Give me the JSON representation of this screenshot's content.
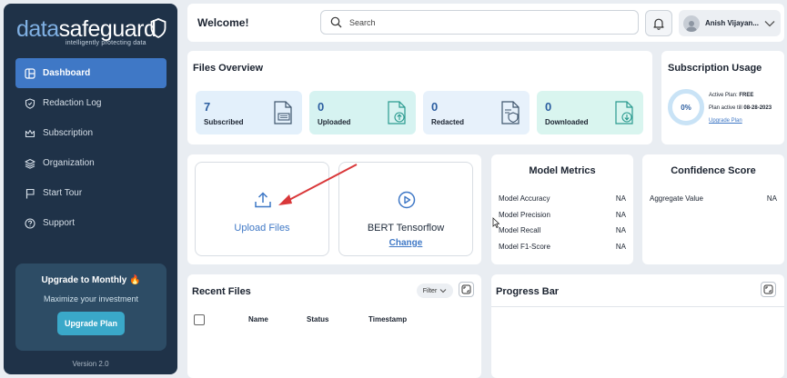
{
  "sidebar": {
    "logo_part1": "data",
    "logo_part2": "safeguard",
    "tagline": "intelligently protecting data",
    "items": [
      {
        "label": "Dashboard",
        "icon": "dashboard-icon",
        "active": true
      },
      {
        "label": "Redaction Log",
        "icon": "shield-icon"
      },
      {
        "label": "Subscription",
        "icon": "crown-icon"
      },
      {
        "label": "Organization",
        "icon": "layers-icon"
      },
      {
        "label": "Start Tour",
        "icon": "flag-icon"
      },
      {
        "label": "Support",
        "icon": "help-icon"
      }
    ],
    "upgrade": {
      "title": "Upgrade to Monthly",
      "subtitle": "Maximize your investment",
      "button": "Upgrade Plan"
    },
    "version": "Version 2.0"
  },
  "header": {
    "welcome": "Welcome!",
    "search_placeholder": "Search",
    "user_name": "Anish Vijayan..."
  },
  "files_overview": {
    "title": "Files Overview",
    "stats": [
      {
        "value": "7",
        "label": "Subscribed",
        "color": "#e3f0fb"
      },
      {
        "value": "0",
        "label": "Uploaded",
        "color": "#d6f3f1"
      },
      {
        "value": "0",
        "label": "Redacted",
        "color": "#e7f1fb"
      },
      {
        "value": "0",
        "label": "Downloaded",
        "color": "#d9f5ef"
      }
    ]
  },
  "subscription_usage": {
    "title": "Subscription Usage",
    "percent": "0%",
    "active_plan_label": "Active Plan:",
    "active_plan": "FREE",
    "active_till_label": "Plan active till",
    "active_till": "08-28-2023",
    "upgrade_link": "Upgrade Plan"
  },
  "model": {
    "upload_label": "Upload Files",
    "model_name": "BERT Tensorflow",
    "change_label": "Change"
  },
  "metrics": {
    "title": "Model Metrics",
    "rows": [
      {
        "label": "Model Accuracy",
        "value": "NA"
      },
      {
        "label": "Model Precision",
        "value": "NA"
      },
      {
        "label": "Model Recall",
        "value": "NA"
      },
      {
        "label": "Model F1-Score",
        "value": "NA"
      }
    ]
  },
  "confidence": {
    "title": "Confidence Score",
    "label": "Aggregate Value",
    "value": "NA"
  },
  "recent_files": {
    "title": "Recent Files",
    "filter": "Filter",
    "columns": [
      "Name",
      "Status",
      "Timestamp"
    ]
  },
  "progress": {
    "title": "Progress Bar"
  },
  "colors": {
    "sidebar_bg": "#1f3248",
    "accent": "#3f78c6",
    "annotation_arrow": "#d9383a"
  }
}
